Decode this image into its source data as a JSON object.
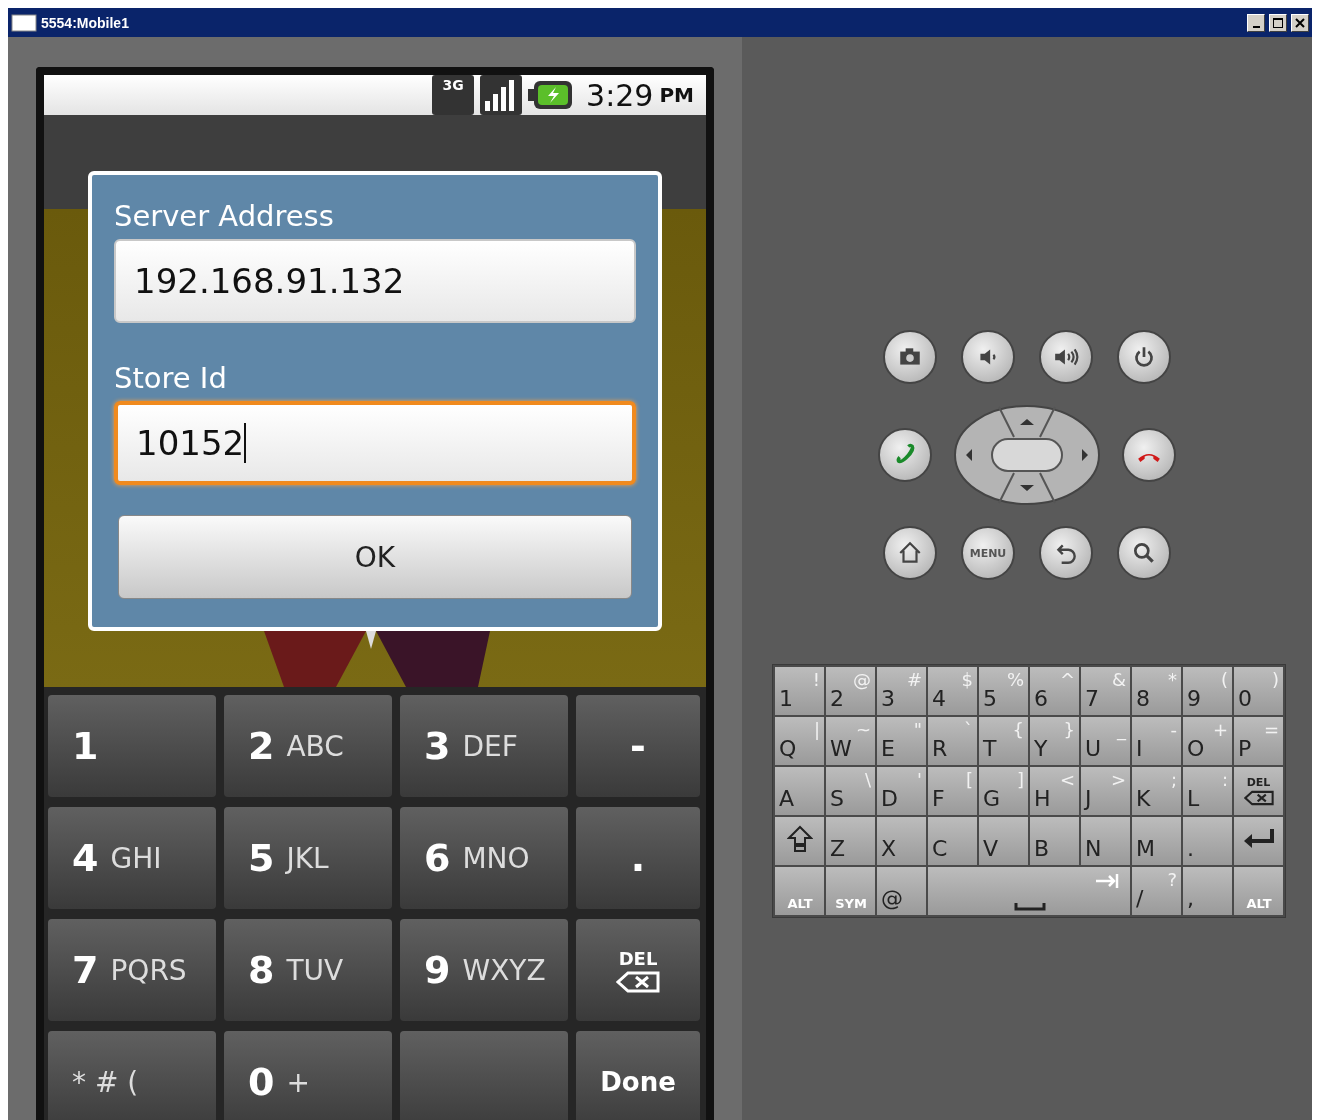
{
  "window": {
    "title": "5554:Mobile1"
  },
  "status_bar": {
    "network": "3G",
    "time": "3:29",
    "period": "PM"
  },
  "dialog": {
    "fields": [
      {
        "label": "Server Address",
        "value": "192.168.91.132",
        "focused": false
      },
      {
        "label": "Store Id",
        "value": "10152",
        "focused": true
      }
    ],
    "button": "OK"
  },
  "keypad": {
    "rows": [
      [
        {
          "kind": "digit",
          "main": "1"
        },
        {
          "kind": "digit",
          "main": "2",
          "sub": "ABC"
        },
        {
          "kind": "digit",
          "main": "3",
          "sub": "DEF"
        },
        {
          "kind": "symbol",
          "main": "-"
        }
      ],
      [
        {
          "kind": "digit",
          "main": "4",
          "sub": "GHI"
        },
        {
          "kind": "digit",
          "main": "5",
          "sub": "JKL"
        },
        {
          "kind": "digit",
          "main": "6",
          "sub": "MNO"
        },
        {
          "kind": "symbol",
          "main": "."
        }
      ],
      [
        {
          "kind": "digit",
          "main": "7",
          "sub": "PQRS"
        },
        {
          "kind": "digit",
          "main": "8",
          "sub": "TUV"
        },
        {
          "kind": "digit",
          "main": "9",
          "sub": "WXYZ"
        },
        {
          "kind": "del",
          "main": "DEL"
        }
      ],
      [
        {
          "kind": "digit",
          "sub": "* # ("
        },
        {
          "kind": "digit",
          "main": "0",
          "sub": "+"
        },
        {
          "kind": "blank"
        },
        {
          "kind": "done",
          "main": "Done"
        }
      ]
    ]
  },
  "hardware_buttons": [
    [
      {
        "kind": "camera"
      },
      {
        "kind": "volume-down"
      },
      {
        "kind": "volume-up"
      },
      {
        "kind": "power"
      }
    ],
    [
      {
        "kind": "call"
      },
      {
        "kind": "dpad"
      },
      {
        "kind": "end-call"
      }
    ],
    [
      {
        "kind": "home"
      },
      {
        "kind": "menu",
        "label": "MENU"
      },
      {
        "kind": "back"
      },
      {
        "kind": "search"
      }
    ]
  ],
  "keyboard": {
    "keys": [
      {
        "kind": "char",
        "main": "1",
        "alt": "!"
      },
      {
        "kind": "char",
        "main": "2",
        "alt": "@"
      },
      {
        "kind": "char",
        "main": "3",
        "alt": "#"
      },
      {
        "kind": "char",
        "main": "4",
        "alt": "$"
      },
      {
        "kind": "char",
        "main": "5",
        "alt": "%"
      },
      {
        "kind": "char",
        "main": "6",
        "alt": "^"
      },
      {
        "kind": "char",
        "main": "7",
        "alt": "&"
      },
      {
        "kind": "char",
        "main": "8",
        "alt": "*"
      },
      {
        "kind": "char",
        "main": "9",
        "alt": "("
      },
      {
        "kind": "char",
        "main": "0",
        "alt": ")"
      },
      {
        "kind": "char",
        "main": "Q",
        "alt": "|"
      },
      {
        "kind": "char",
        "main": "W",
        "alt": "~"
      },
      {
        "kind": "char",
        "main": "E",
        "alt": "\""
      },
      {
        "kind": "char",
        "main": "R",
        "alt": "`"
      },
      {
        "kind": "char",
        "main": "T",
        "alt": "{"
      },
      {
        "kind": "char",
        "main": "Y",
        "alt": "}"
      },
      {
        "kind": "char",
        "main": "U",
        "alt": "_"
      },
      {
        "kind": "char",
        "main": "I",
        "alt": "-"
      },
      {
        "kind": "char",
        "main": "O",
        "alt": "+"
      },
      {
        "kind": "char",
        "main": "P",
        "alt": "="
      },
      {
        "kind": "char",
        "main": "A"
      },
      {
        "kind": "char",
        "main": "S",
        "alt": "\\"
      },
      {
        "kind": "char",
        "main": "D",
        "alt": "'"
      },
      {
        "kind": "char",
        "main": "F",
        "alt": "["
      },
      {
        "kind": "char",
        "main": "G",
        "alt": "]"
      },
      {
        "kind": "char",
        "main": "H",
        "alt": "<"
      },
      {
        "kind": "char",
        "main": "J",
        "alt": ">"
      },
      {
        "kind": "char",
        "main": "K",
        "alt": ";"
      },
      {
        "kind": "char",
        "main": "L",
        "alt": ":"
      },
      {
        "kind": "del",
        "main": "DEL"
      },
      {
        "kind": "shift"
      },
      {
        "kind": "char",
        "main": "Z"
      },
      {
        "kind": "char",
        "main": "X"
      },
      {
        "kind": "char",
        "main": "C"
      },
      {
        "kind": "char",
        "main": "V"
      },
      {
        "kind": "char",
        "main": "B"
      },
      {
        "kind": "char",
        "main": "N"
      },
      {
        "kind": "char",
        "main": "M"
      },
      {
        "kind": "char",
        "main": "."
      },
      {
        "kind": "enter"
      },
      {
        "kind": "mod",
        "main": "ALT"
      },
      {
        "kind": "mod",
        "main": "SYM"
      },
      {
        "kind": "char",
        "main": "@"
      },
      {
        "kind": "space"
      },
      {
        "kind": "char",
        "main": "/",
        "alt": "?"
      },
      {
        "kind": "char",
        "main": ","
      },
      {
        "kind": "mod",
        "main": "ALT"
      }
    ]
  }
}
